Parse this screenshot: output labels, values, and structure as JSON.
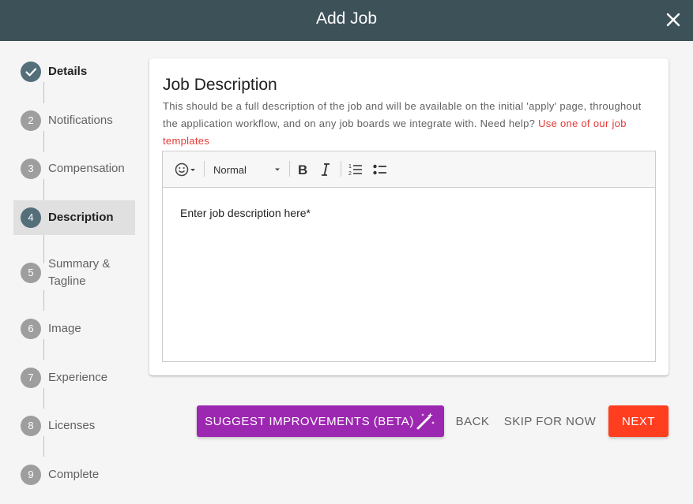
{
  "dialog": {
    "title": "Add Job",
    "close_icon": "close-icon"
  },
  "stepper": {
    "steps": [
      {
        "number": "",
        "label": "Details",
        "state": "completed"
      },
      {
        "number": "2",
        "label": "Notifications",
        "state": "pending"
      },
      {
        "number": "3",
        "label": "Compensation",
        "state": "pending"
      },
      {
        "number": "4",
        "label": "Description",
        "state": "active"
      },
      {
        "number": "5",
        "label": "Summary & Tagline",
        "state": "pending"
      },
      {
        "number": "6",
        "label": "Image",
        "state": "pending"
      },
      {
        "number": "7",
        "label": "Experience",
        "state": "pending"
      },
      {
        "number": "8",
        "label": "Licenses",
        "state": "pending"
      },
      {
        "number": "9",
        "label": "Complete",
        "state": "pending"
      }
    ]
  },
  "card": {
    "title": "Job Description",
    "description": "This should be a full description of the job and will be available on the initial 'apply' page, throughout the application workflow, and on any job boards we integrate with. Need help?",
    "help_link": "Use one of our job templates"
  },
  "editor": {
    "format_value": "Normal",
    "placeholder": "Enter job description here*",
    "toolbar_icons": [
      "emoji-icon",
      "bold-icon",
      "italic-icon",
      "ordered-list-icon",
      "bullet-list-icon"
    ]
  },
  "actions": {
    "suggest_label": "Suggest Improvements (Beta)",
    "back_label": "Back",
    "skip_label": "Skip for now",
    "next_label": "Next"
  },
  "colors": {
    "header_bg": "#3d5159",
    "step_active": "#546e7a",
    "link": "#e53935",
    "suggest_button": "#9c27b0",
    "next_button": "#ff3d1f"
  }
}
